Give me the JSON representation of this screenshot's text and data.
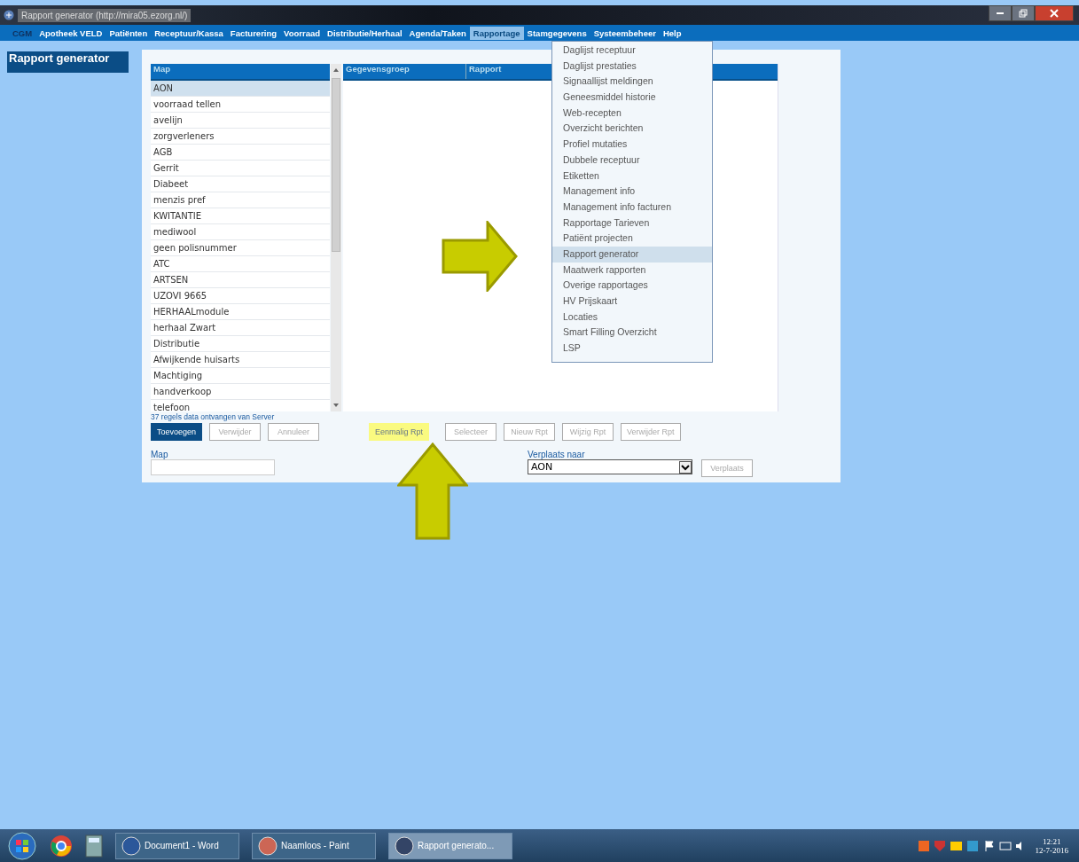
{
  "window": {
    "title": "Rapport generator (http://mira05.ezorg.nl/)"
  },
  "menu": [
    {
      "label": "CGM",
      "selected": false,
      "kind": "logo"
    },
    {
      "label": "Apotheek VELD",
      "selected": false,
      "kind": "item"
    },
    {
      "label": "Patiënten",
      "selected": false,
      "kind": "item"
    },
    {
      "label": "Receptuur/Kassa",
      "selected": false,
      "kind": "item"
    },
    {
      "label": "Facturering",
      "selected": false,
      "kind": "item"
    },
    {
      "label": "Voorraad",
      "selected": false,
      "kind": "item"
    },
    {
      "label": "Distributie/Herhaal",
      "selected": false,
      "kind": "item"
    },
    {
      "label": "Agenda/Taken",
      "selected": false,
      "kind": "item"
    },
    {
      "label": "Rapportage",
      "selected": true,
      "kind": "item"
    },
    {
      "label": "Stamgegevens",
      "selected": false,
      "kind": "item"
    },
    {
      "label": "Systeembeheer",
      "selected": false,
      "kind": "item"
    },
    {
      "label": "Help",
      "selected": false,
      "kind": "item"
    }
  ],
  "dropdown": [
    {
      "label": "Daglijst receptuur",
      "selected": false
    },
    {
      "label": "Daglijst prestaties",
      "selected": false
    },
    {
      "label": "Signaallijst meldingen",
      "selected": false
    },
    {
      "label": "Geneesmiddel historie",
      "selected": false
    },
    {
      "label": "Web-recepten",
      "selected": false
    },
    {
      "label": "Overzicht berichten",
      "selected": false
    },
    {
      "label": "Profiel mutaties",
      "selected": false
    },
    {
      "label": "Dubbele receptuur",
      "selected": false
    },
    {
      "label": "Etiketten",
      "selected": false
    },
    {
      "label": "Management info",
      "selected": false
    },
    {
      "label": "Management info facturen",
      "selected": false
    },
    {
      "label": "Rapportage Tarieven",
      "selected": false
    },
    {
      "label": "Patiënt projecten",
      "selected": false
    },
    {
      "label": "Rapport generator",
      "selected": true
    },
    {
      "label": "Maatwerk rapporten",
      "selected": false
    },
    {
      "label": "Overige rapportages",
      "selected": false
    },
    {
      "label": "HV Prijskaart",
      "selected": false
    },
    {
      "label": "Locaties",
      "selected": false
    },
    {
      "label": "Smart Filling Overzicht",
      "selected": false
    },
    {
      "label": "LSP",
      "selected": false
    }
  ],
  "page_tab": "Rapport generator",
  "map_list": {
    "header": "Map",
    "rows": [
      {
        "label": "AON",
        "selected": true
      },
      {
        "label": "voorraad tellen",
        "selected": false
      },
      {
        "label": "avelijn",
        "selected": false
      },
      {
        "label": "zorgverleners",
        "selected": false
      },
      {
        "label": "AGB",
        "selected": false
      },
      {
        "label": "Gerrit",
        "selected": false
      },
      {
        "label": "Diabeet",
        "selected": false
      },
      {
        "label": "menzis pref",
        "selected": false
      },
      {
        "label": "KWITANTIE",
        "selected": false
      },
      {
        "label": "mediwool",
        "selected": false
      },
      {
        "label": "geen polisnummer",
        "selected": false
      },
      {
        "label": "ATC",
        "selected": false
      },
      {
        "label": "ARTSEN",
        "selected": false
      },
      {
        "label": "UZOVI 9665",
        "selected": false
      },
      {
        "label": "HERHAALmodule",
        "selected": false
      },
      {
        "label": "herhaal Zwart",
        "selected": false
      },
      {
        "label": "Distributie",
        "selected": false
      },
      {
        "label": "Afwijkende huisarts",
        "selected": false
      },
      {
        "label": "Machtiging",
        "selected": false
      },
      {
        "label": "handverkoop",
        "selected": false
      },
      {
        "label": "telefoon",
        "selected": false
      }
    ]
  },
  "report_table": {
    "columns": [
      "Gegevensgroep",
      "Rapport"
    ]
  },
  "status": "37 regels data ontvangen van Server",
  "buttons": [
    {
      "label": "Toevoegen",
      "kind": "primary",
      "disabled": false
    },
    {
      "label": "Verwijder",
      "kind": "normal",
      "disabled": true
    },
    {
      "label": "Annuleer",
      "kind": "normal",
      "disabled": true
    },
    {
      "label": "Eenmalig Rpt",
      "kind": "highlight",
      "disabled": false
    },
    {
      "label": "Selecteer",
      "kind": "normal",
      "disabled": true
    },
    {
      "label": "Nieuw Rpt",
      "kind": "normal",
      "disabled": true
    },
    {
      "label": "Wijzig Rpt",
      "kind": "normal",
      "disabled": true
    },
    {
      "label": "Verwijder Rpt",
      "kind": "normal",
      "disabled": true
    }
  ],
  "map_field": {
    "label": "Map"
  },
  "move_to": {
    "label": "Verplaats naar",
    "value": "AON",
    "button": "Verplaats",
    "disabled": true
  },
  "taskbar": {
    "tasks": [
      {
        "label": "Document1 - Word",
        "selected": false
      },
      {
        "label": "Naamloos - Paint",
        "selected": false
      },
      {
        "label": "Rapport generato...",
        "selected": true
      }
    ],
    "time": "12:21",
    "date": "12-7-2016"
  }
}
